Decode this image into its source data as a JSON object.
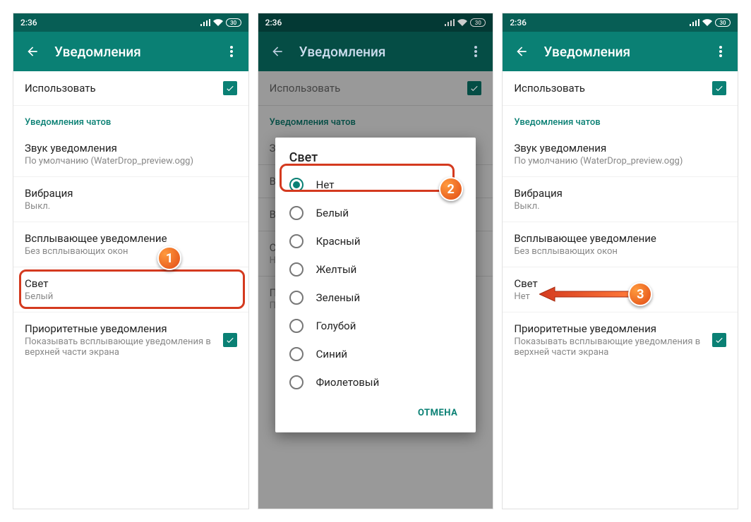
{
  "status": {
    "time": "2:36",
    "battery": "30"
  },
  "appbar": {
    "title": "Уведомления"
  },
  "section_header": "Уведомления чатов",
  "rows": {
    "use": {
      "title": "Использовать"
    },
    "sound": {
      "title": "Звук уведомления",
      "sub": "По умолчанию (WaterDrop_preview.ogg)"
    },
    "vibration": {
      "title": "Вибрация",
      "sub": "Выкл."
    },
    "popup": {
      "title": "Всплывающее уведомление",
      "sub": "Без всплывающих окон"
    },
    "light_before": {
      "title": "Свет",
      "sub": "Белый"
    },
    "light_after": {
      "title": "Свет",
      "sub": "Нет"
    },
    "priority": {
      "title": "Приоритетные уведомления",
      "sub": "Показывать всплывающие уведомления в верхней части экрана"
    }
  },
  "dialog": {
    "title": "Свет",
    "options": [
      "Нет",
      "Белый",
      "Красный",
      "Желтый",
      "Зеленый",
      "Голубой",
      "Синий",
      "Фиолетовый"
    ],
    "cancel": "ОТМЕНА",
    "selected_index": 0
  },
  "annotations": {
    "1": "1",
    "2": "2",
    "3": "3"
  }
}
